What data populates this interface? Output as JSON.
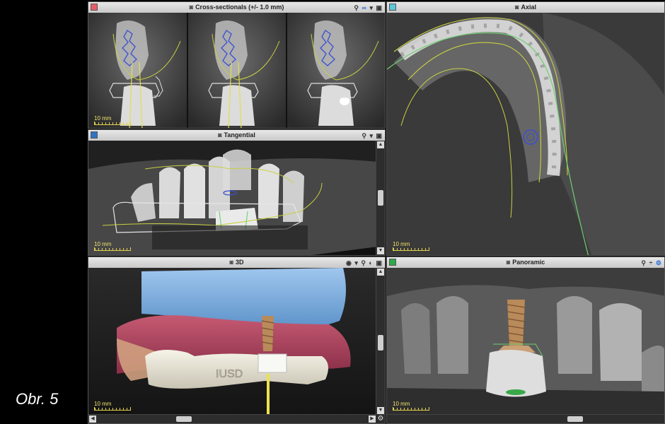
{
  "caption": "Obr. 5",
  "panels": {
    "cross_sectionals": {
      "title": "Cross-sectionals (+/- 1.0 mm)",
      "color": "#e85c6a",
      "scale": "10 mm"
    },
    "axial": {
      "title": "Axial",
      "color": "#5cc8d8",
      "scale": "10 mm"
    },
    "tangential": {
      "title": "Tangential",
      "color": "#2f74c7",
      "scale": "10 mm"
    },
    "three_d": {
      "title": "3D",
      "scale": "10 mm",
      "guide_label": "IUSD"
    },
    "panoramic": {
      "title": "Panoramic",
      "color": "#2fa84a",
      "scale": "10 mm"
    }
  },
  "icons": {
    "camera": "camera-icon",
    "zoom": "zoom-icon",
    "link": "link-icon",
    "dropdown": "chevron-down-icon",
    "maximize": "maximize-icon",
    "eye": "eye-icon",
    "settings": "gear-icon"
  }
}
